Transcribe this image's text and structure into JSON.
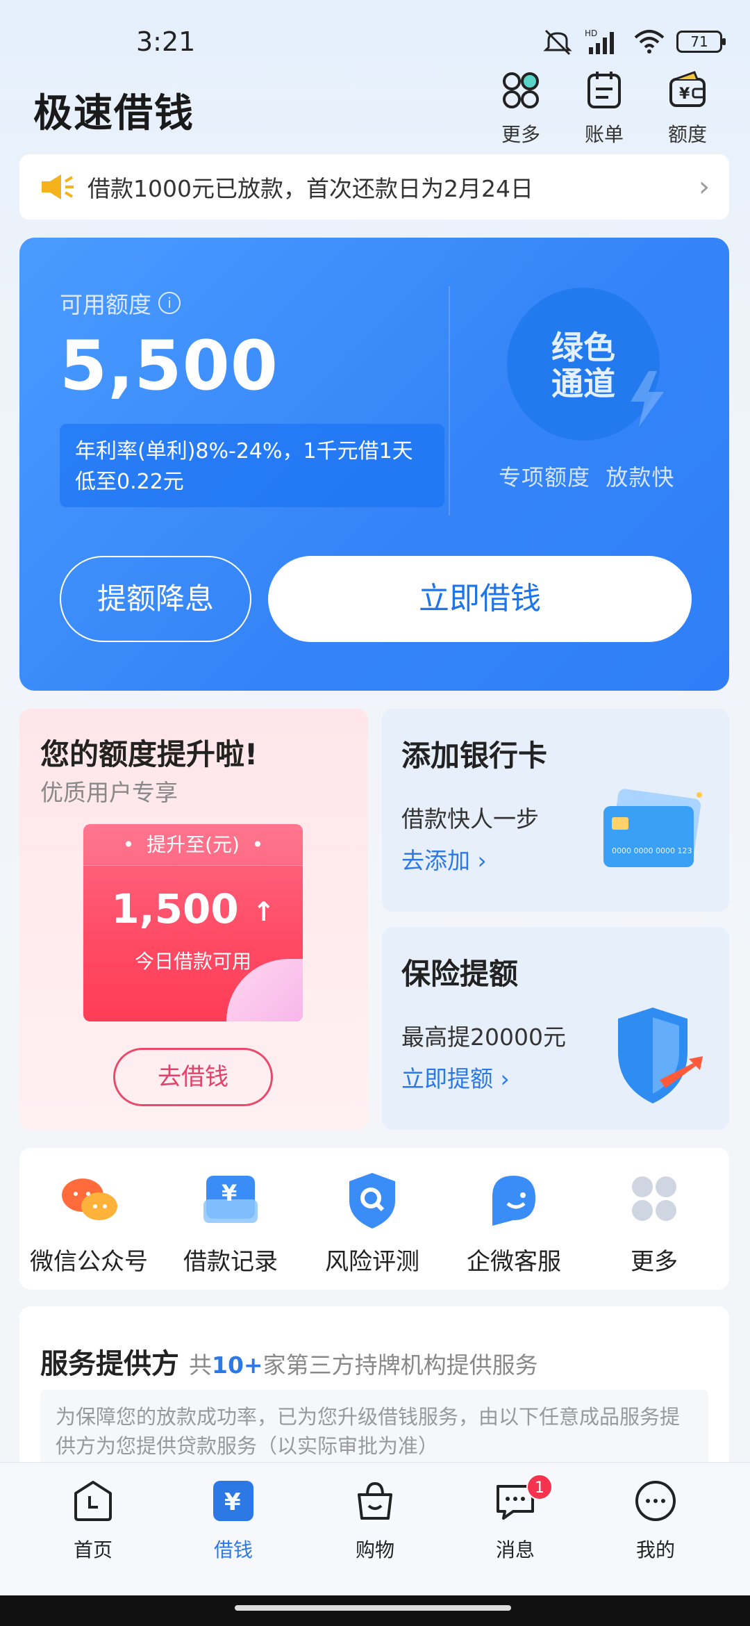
{
  "status": {
    "time": "3:21",
    "battery": "71"
  },
  "header": {
    "title": "极速借钱",
    "more_label": "更多",
    "bill_label": "账单",
    "quota_label": "额度"
  },
  "notice": {
    "text": "借款1000元已放款，首次还款日为2月24日"
  },
  "credit": {
    "available_label": "可用额度",
    "amount": "5,500",
    "rate_text": "年利率(单利)8%-24%，1千元借1天低至0.22元",
    "badge_line1": "绿色",
    "badge_line2": "通道",
    "badge_note": "专项额度  放款快",
    "raise_button": "提额降息",
    "borrow_button": "立即借钱",
    "colors": {
      "card": "#3585f8",
      "accent": "#1e74e8"
    }
  },
  "promo": {
    "title": "您的额度提升啦!",
    "subtitle": "优质用户专享",
    "card_top": "•  提升至(元)  •",
    "card_amount": "1,500",
    "card_note": "今日借款可用",
    "button": "去借钱"
  },
  "bank_card": {
    "title": "添加银行卡",
    "subtitle": "借款快人一步",
    "link": "去添加 ›"
  },
  "insurance": {
    "title": "保险提额",
    "subtitle": "最高提20000元",
    "link": "立即提额 ›"
  },
  "quick_actions": [
    {
      "label": "微信公众号",
      "icon": "wechat-official-icon"
    },
    {
      "label": "借款记录",
      "icon": "loan-record-icon"
    },
    {
      "label": "风险评测",
      "icon": "risk-assessment-icon"
    },
    {
      "label": "企微客服",
      "icon": "customer-service-icon"
    },
    {
      "label": "更多",
      "icon": "more-grid-icon"
    }
  ],
  "provider": {
    "title": "服务提供方",
    "desc_prefix": "共",
    "desc_count": "10+",
    "desc_suffix": "家第三方持牌机构提供服务",
    "note": "为保障您的放款成功率，已为您升级借钱服务，由以下任意成品服务提供方为您提供贷款服务（以实际审批为准）"
  },
  "tabs": [
    {
      "label": "首页",
      "icon": "home-clock-icon"
    },
    {
      "label": "借钱",
      "icon": "yuan-icon"
    },
    {
      "label": "购物",
      "icon": "shopping-bag-icon"
    },
    {
      "label": "消息",
      "icon": "message-icon",
      "badge": "1"
    },
    {
      "label": "我的",
      "icon": "profile-icon"
    }
  ]
}
